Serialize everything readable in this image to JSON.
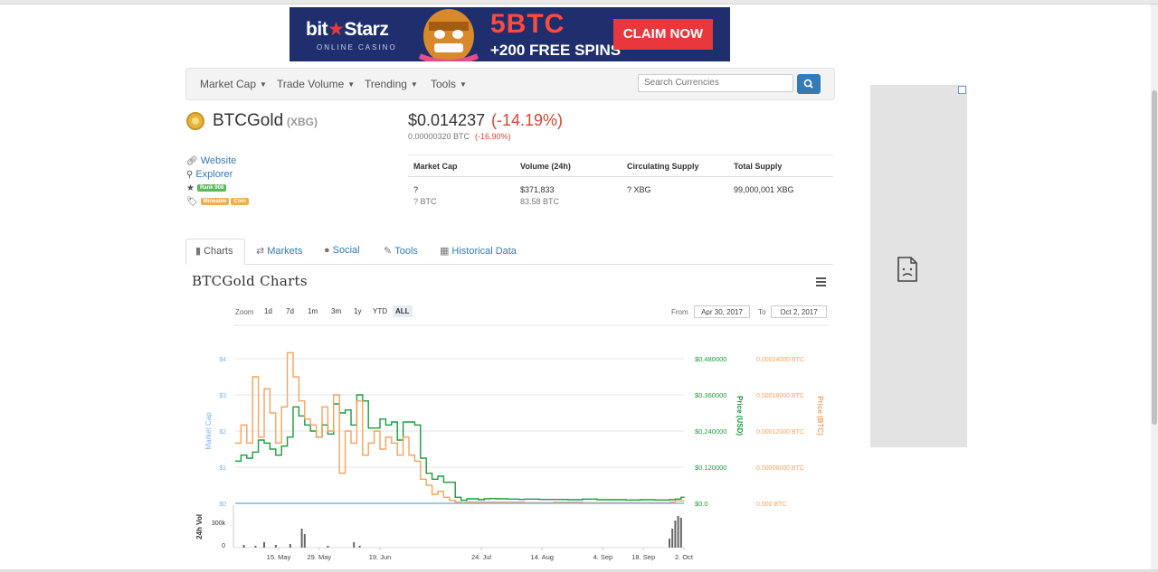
{
  "banner": {
    "brand_left": "bit",
    "brand_right": "Starz",
    "brand_sub": "ONLINE CASINO",
    "offer_main": "5BTC",
    "offer_sub": "+200 FREE SPINS",
    "cta": "CLAIM NOW"
  },
  "nav": {
    "items": [
      {
        "label": "Market Cap"
      },
      {
        "label": "Trade Volume"
      },
      {
        "label": "Trending"
      },
      {
        "label": "Tools"
      }
    ],
    "search_placeholder": "Search Currencies"
  },
  "coin": {
    "name": "BTCGold",
    "symbol": "(XBG)",
    "price_usd": "$0.014237",
    "change_usd": "(-14.19%)",
    "price_btc": "0.00000320 BTC",
    "change_btc": "(-16.90%)",
    "links": {
      "website": "Website",
      "explorer": "Explorer",
      "rank": "Rank 908",
      "tags": [
        "Mineable",
        "Coin"
      ]
    }
  },
  "stats": {
    "headers": [
      "Market Cap",
      "Volume (24h)",
      "Circulating Supply",
      "Total Supply"
    ],
    "market_cap": {
      "usd": "?",
      "btc": "? BTC"
    },
    "volume": {
      "usd": "$371,833",
      "btc": "83.58 BTC"
    },
    "circulating": "? XBG",
    "total": "99,000,001 XBG"
  },
  "tabs": [
    {
      "label": "Charts",
      "active": true
    },
    {
      "label": "Markets"
    },
    {
      "label": "Social"
    },
    {
      "label": "Tools"
    },
    {
      "label": "Historical Data"
    }
  ],
  "chart_header": {
    "title": "BTCGold Charts",
    "zoom_label": "Zoom",
    "zoom_options": [
      "1d",
      "7d",
      "1m",
      "3m",
      "1y",
      "YTD",
      "ALL"
    ],
    "zoom_selected": "ALL",
    "from_label": "From",
    "from_value": "Apr 30, 2017",
    "to_label": "To",
    "to_value": "Oct 2, 2017"
  },
  "chart_data": {
    "type": "line",
    "x_ticks": [
      "15. May",
      "29. May",
      "19. Jun",
      "24. Jul",
      "14. Aug",
      "4. Sep",
      "18. Sep",
      "2. Oct"
    ],
    "x_range": [
      "2017-04-30",
      "2017-10-02"
    ],
    "axes": {
      "market_cap": {
        "label": "Market Cap",
        "ticks": [
          "$0",
          "$1",
          "$2",
          "$3",
          "$4"
        ],
        "range": [
          0,
          4
        ],
        "color": "#7cb5ec"
      },
      "price_usd": {
        "label": "Price (USD)",
        "ticks": [
          "$0.0",
          "$0.120000",
          "$0.240000",
          "$0.360000",
          "$0.480000"
        ],
        "range": [
          0,
          0.48
        ],
        "color": "#1a9c3e"
      },
      "price_btc": {
        "label": "Price (BTC)",
        "ticks": [
          "0.000 BTC",
          "0.00006000 BTC",
          "0.00012000 BTC",
          "0.00018000 BTC",
          "0.00024000 BTC"
        ],
        "range": [
          0,
          0.00024
        ],
        "color": "#f7a35c"
      },
      "volume": {
        "label": "24h Vol",
        "ticks": [
          "0",
          "300k"
        ],
        "range": [
          0,
          400000
        ],
        "color": "#666666"
      }
    },
    "series": [
      {
        "name": "Price (USD)",
        "color": "#1a9c3e",
        "x": [
          0,
          2,
          4,
          6,
          8,
          10,
          12,
          14,
          16,
          18,
          20,
          22,
          24,
          26,
          28,
          30,
          32,
          34,
          36,
          38,
          40,
          42,
          44,
          46,
          48,
          50,
          52,
          54,
          56,
          58,
          60,
          62,
          64,
          66,
          68,
          70,
          72,
          74,
          76,
          78,
          80,
          82,
          84,
          86,
          88,
          90,
          92,
          94,
          96,
          98,
          100,
          105,
          110,
          115,
          120,
          125,
          130,
          135,
          140,
          145,
          150,
          152,
          154,
          155
        ],
        "y": [
          0.14,
          0.16,
          0.15,
          0.17,
          0.21,
          0.2,
          0.18,
          0.16,
          0.19,
          0.22,
          0.32,
          0.29,
          0.26,
          0.24,
          0.22,
          0.26,
          0.23,
          0.33,
          0.3,
          0.31,
          0.26,
          0.36,
          0.34,
          0.25,
          0.25,
          0.28,
          0.26,
          0.27,
          0.21,
          0.27,
          0.27,
          0.26,
          0.15,
          0.1,
          0.08,
          0.09,
          0.07,
          0.07,
          0.02,
          0.01,
          0.015,
          0.015,
          0.012,
          0.015,
          0.016,
          0.015,
          0.015,
          0.014,
          0.014,
          0.013,
          0.014,
          0.013,
          0.013,
          0.012,
          0.014,
          0.012,
          0.012,
          0.011,
          0.012,
          0.011,
          0.012,
          0.014,
          0.02,
          0.018
        ]
      },
      {
        "name": "Price (BTC)",
        "color": "#f7a35c",
        "x": [
          0,
          2,
          4,
          6,
          8,
          10,
          12,
          14,
          16,
          18,
          20,
          22,
          24,
          26,
          28,
          30,
          32,
          34,
          36,
          38,
          40,
          42,
          44,
          46,
          48,
          50,
          52,
          54,
          56,
          58,
          60,
          62,
          64,
          66,
          68,
          70,
          72,
          74,
          76,
          78,
          80,
          90,
          100,
          110,
          120,
          130,
          140,
          150,
          152,
          155
        ],
        "y": [
          0.0001,
          0.00013,
          0.0001,
          0.00021,
          0.00011,
          0.00019,
          0.00015,
          0.0001,
          0.00016,
          0.00025,
          0.00021,
          0.00017,
          0.00014,
          0.00013,
          0.00011,
          0.00016,
          0.00012,
          0.00018,
          5e-05,
          0.00012,
          0.0001,
          0.00017,
          8e-05,
          0.0001,
          0.00012,
          9e-05,
          0.00011,
          0.0001,
          8e-05,
          0.00011,
          8e-05,
          7e-05,
          4e-05,
          3e-05,
          1.5e-05,
          2e-05,
          1e-05,
          5e-06,
          2e-06,
          1e-06,
          2e-06,
          2e-06,
          1e-06,
          2e-06,
          1e-06,
          1e-06,
          1e-06,
          2e-06,
          4e-06,
          3e-06
        ]
      },
      {
        "name": "Market Cap",
        "color": "#7cb5ec",
        "x": [
          0,
          155
        ],
        "y": [
          0,
          0
        ]
      },
      {
        "name": "24h Vol",
        "color": "#666666",
        "type": "column",
        "x": [
          3,
          7,
          10,
          14,
          19,
          23,
          24,
          32,
          41,
          43,
          150,
          151,
          152,
          153,
          154
        ],
        "y": [
          30000,
          20000,
          60000,
          30000,
          40000,
          210000,
          150000,
          20000,
          60000,
          20000,
          100000,
          210000,
          300000,
          350000,
          330000
        ]
      }
    ]
  },
  "ad": {}
}
